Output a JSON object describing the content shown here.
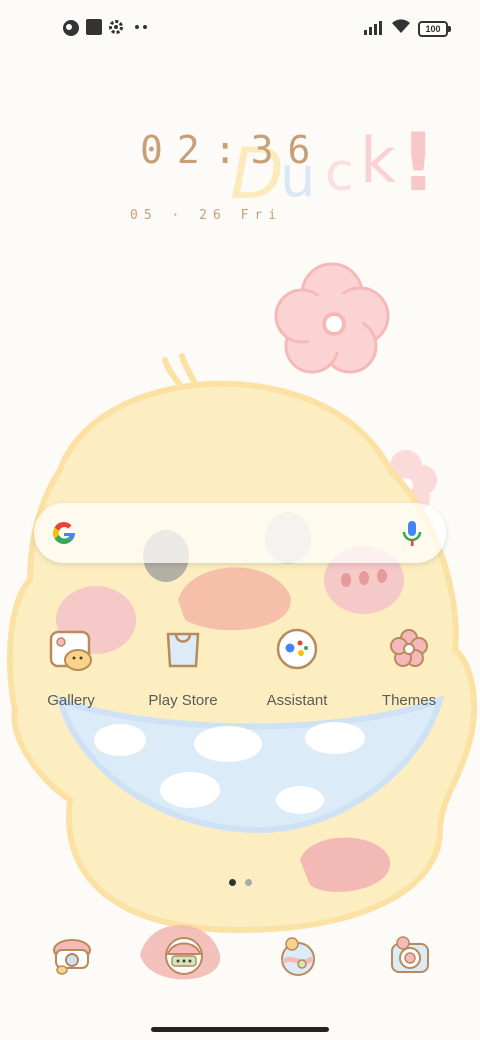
{
  "status_bar": {
    "battery": "100",
    "left_icons": [
      "theme-icon",
      "square-icon",
      "settings-icon",
      "more-dots-icon"
    ],
    "right_icons": [
      "signal-icon",
      "wifi-icon",
      "battery-icon"
    ]
  },
  "wallpaper": {
    "text": "Duck!"
  },
  "clock": {
    "time": "02:36",
    "date": "05 · 26  Fri"
  },
  "search": {
    "icons": [
      "google-logo-icon",
      "microphone-icon"
    ]
  },
  "apps": [
    {
      "label": "Gallery",
      "icon": "gallery-icon"
    },
    {
      "label": "Play Store",
      "icon": "play-store-icon"
    },
    {
      "label": "Assistant",
      "icon": "assistant-icon"
    },
    {
      "label": "Themes",
      "icon": "themes-icon"
    }
  ],
  "dock": [
    {
      "icon": "phone-icon"
    },
    {
      "icon": "messages-icon"
    },
    {
      "icon": "browser-icon"
    },
    {
      "icon": "camera-icon"
    }
  ],
  "pager": {
    "count": 2,
    "active": 0
  },
  "colors": {
    "wallpaper_bg": "#fdfbf7",
    "duck_yellow": "#fdeec2",
    "pink": "#f6c9c9",
    "clock_tan": "#c7a07a"
  }
}
